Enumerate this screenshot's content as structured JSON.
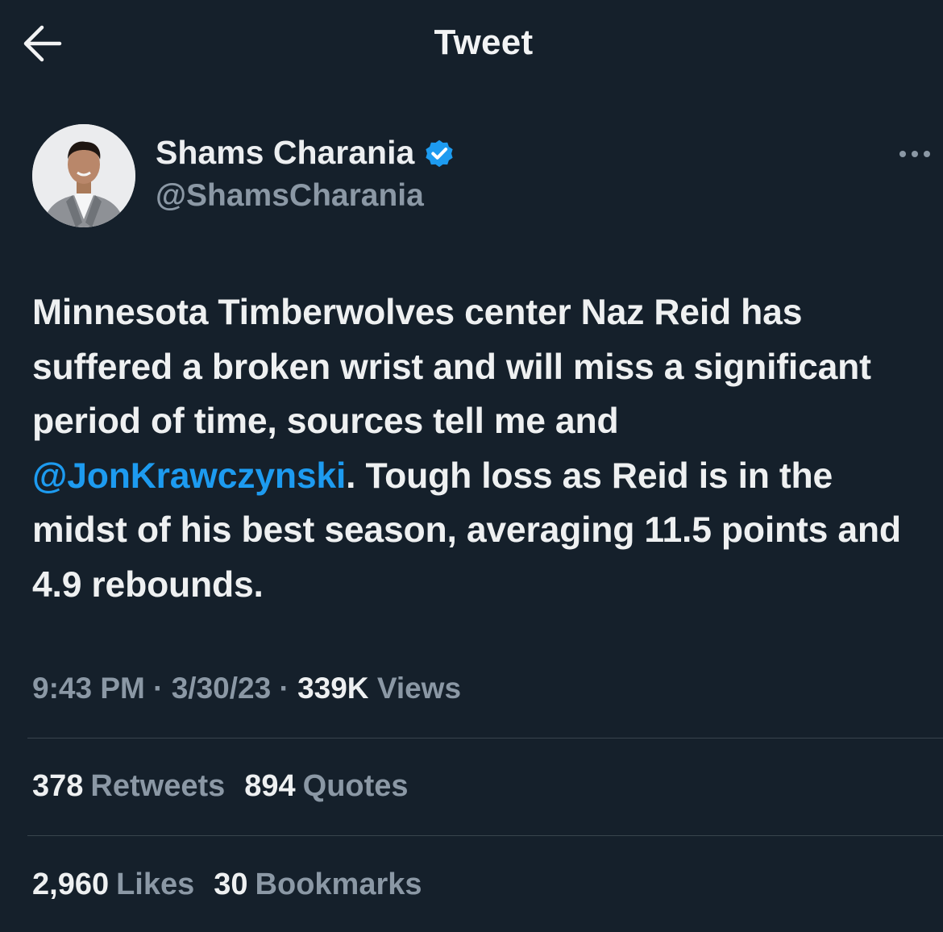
{
  "header": {
    "title": "Tweet",
    "back_icon": "arrow-left-icon"
  },
  "author": {
    "name": "Shams Charania",
    "handle": "@ShamsCharania",
    "verified_icon": "verified-badge-icon",
    "verified_color": "#1d9bf0",
    "more_icon": "more-horizontal-icon"
  },
  "tweet": {
    "text_part1": "Minnesota Timberwolves center Naz Reid has suffered a broken wrist and will miss a significant period of time, sources tell me and ",
    "mention": "@JonKrawczynski",
    "text_part2": ". Tough loss as Reid is in the midst of his best season, averaging 11.5 points and 4.9 rebounds."
  },
  "meta": {
    "time": "9:43 PM",
    "separator": "·",
    "date": "3/30/23",
    "views_count": "339K",
    "views_label": "Views"
  },
  "stats": {
    "retweets_count": "378",
    "retweets_label": "Retweets",
    "quotes_count": "894",
    "quotes_label": "Quotes",
    "likes_count": "2,960",
    "likes_label": "Likes",
    "bookmarks_count": "30",
    "bookmarks_label": "Bookmarks"
  },
  "colors": {
    "background": "#15202b",
    "accent": "#1d9bf0",
    "secondary_text": "#8b98a5",
    "divider": "#38444d"
  }
}
